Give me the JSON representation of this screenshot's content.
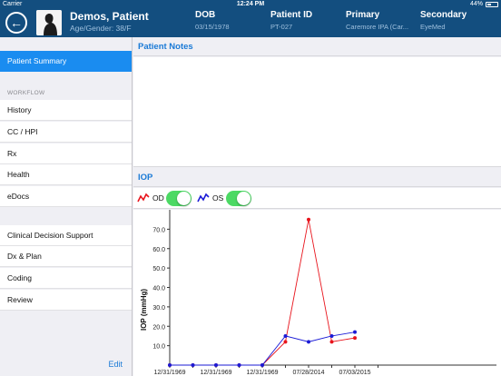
{
  "status": {
    "carrier": "Carrier",
    "time": "12:24 PM",
    "battery": "44%",
    "battery_level": 0.44
  },
  "header": {
    "patient_name": "Demos, Patient",
    "age_gender": "Age/Gender: 38/F",
    "dob_label": "DOB",
    "dob_value": "03/15/1978",
    "pid_label": "Patient ID",
    "pid_value": "PT-027",
    "primary_label": "Primary",
    "primary_value": "Caremore IPA (Car...",
    "secondary_label": "Secondary",
    "secondary_value": "EyeMed"
  },
  "sidebar": {
    "patient_summary": "Patient Summary",
    "workflow_label": "WORKFLOW",
    "workflow_items": [
      "History",
      "CC / HPI",
      "Rx",
      "Health",
      "eDocs"
    ],
    "other_items": [
      "Clinical Decision Support",
      "Dx & Plan",
      "Coding",
      "Review"
    ],
    "edit_label": "Edit"
  },
  "notes": {
    "title": "Patient Notes"
  },
  "iop": {
    "title": "IOP",
    "od_label": "OD",
    "os_label": "OS",
    "od_on": true,
    "os_on": true
  },
  "colors": {
    "od": "#e8141c",
    "os": "#1b1bd6",
    "header": "#134e7f",
    "accent": "#1a8cf0"
  },
  "chart_data": {
    "type": "line",
    "ylabel": "IOP (mmHg)",
    "ylim": [
      0,
      80
    ],
    "y_ticks": [
      "10.0",
      "20.0",
      "30.0",
      "40.0",
      "50.0",
      "60.0",
      "70.0"
    ],
    "y_tick_values": [
      10,
      20,
      30,
      40,
      50,
      60,
      70
    ],
    "x_tick_labels": [
      "12/31/1969",
      "12/31/1969",
      "12/31/1969",
      "07/28/2014",
      "07/03/2015"
    ],
    "x_point_count": 10,
    "x_label_indices": [
      0,
      2,
      4,
      6,
      8
    ],
    "series": [
      {
        "name": "OD",
        "values": [
          0,
          0,
          0,
          0,
          0,
          12,
          75,
          12,
          14,
          null
        ]
      },
      {
        "name": "OS",
        "values": [
          0,
          0,
          0,
          0,
          0,
          15,
          12,
          15,
          17,
          null
        ]
      }
    ]
  }
}
